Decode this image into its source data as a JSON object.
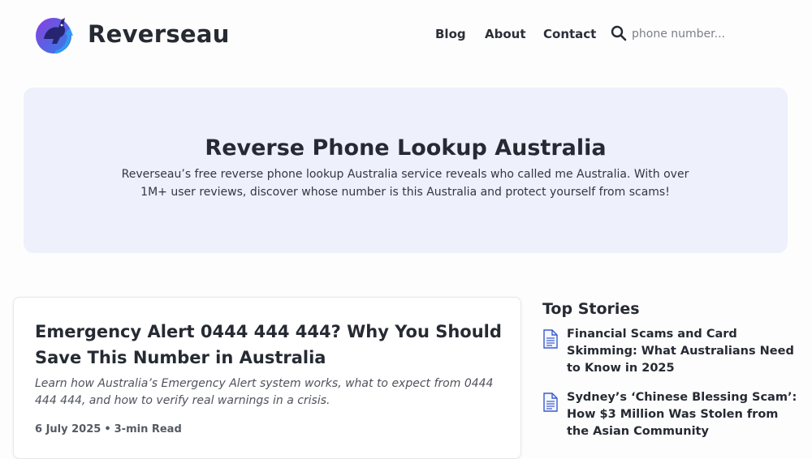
{
  "header": {
    "brand": "Reverseau",
    "nav": {
      "blog": "Blog",
      "about": "About",
      "contact": "Contact"
    },
    "search": {
      "placeholder": "phone number..."
    }
  },
  "hero": {
    "title": "Reverse Phone Lookup Australia",
    "description": "Reverseau’s free reverse phone lookup Australia service reveals who called me Australia. With over 1M+ user reviews, discover whose number is this Australia and protect yourself from scams!"
  },
  "article": {
    "title": "Emergency Alert 0444 444 444? Why You Should Save This Number in Australia",
    "excerpt": "Learn how Australia’s Emergency Alert system works, what to expect from 0444 444 444, and how to verify real warnings in a crisis.",
    "date": "6 July 2025",
    "separator": "•",
    "read_time": "3-min Read"
  },
  "top_stories": {
    "heading": "Top Stories",
    "items": [
      {
        "title": "Financial Scams and Card Skimming: What Australians Need to Know in 2025",
        "icon": "document-icon"
      },
      {
        "title": "Sydney’s ‘Chinese Blessing Scam’: How $3 Million Was Stolen from the Asian Community",
        "icon": "document-icon"
      }
    ]
  },
  "colors": {
    "hero_bg": "#eef1fc",
    "text": "#262a33",
    "logo_purple": "#6a3fd6",
    "logo_blue": "#2f7fe6",
    "icon_blue": "#3b5bc9"
  }
}
